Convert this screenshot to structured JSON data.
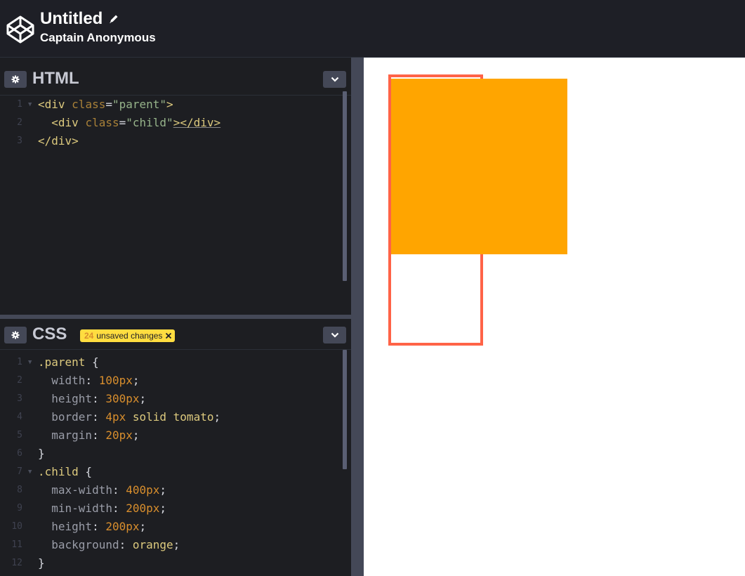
{
  "header": {
    "title": "Untitled",
    "owner": "Captain Anonymous"
  },
  "html_editor": {
    "title": "HTML",
    "lines": [
      {
        "n": "1",
        "fold": true,
        "tokens": [
          [
            "tag",
            "<div "
          ],
          [
            "attr",
            "class"
          ],
          [
            "plain",
            "="
          ],
          [
            "str",
            "\"parent\""
          ],
          [
            "tag",
            ">"
          ]
        ]
      },
      {
        "n": "2",
        "fold": false,
        "tokens": [
          [
            "plain",
            "  "
          ],
          [
            "tag",
            "<div "
          ],
          [
            "attr",
            "class"
          ],
          [
            "plain",
            "="
          ],
          [
            "str",
            "\"child\""
          ],
          [
            "tag",
            "></div>"
          ]
        ]
      },
      {
        "n": "3",
        "fold": false,
        "tokens": [
          [
            "tag",
            "</div>"
          ]
        ]
      }
    ]
  },
  "css_editor": {
    "title": "CSS",
    "badge": {
      "count": "24",
      "label": "unsaved changes"
    },
    "lines": [
      {
        "n": "1",
        "fold": true,
        "tokens": [
          [
            "sel",
            ".parent"
          ],
          [
            "plain",
            " {"
          ]
        ]
      },
      {
        "n": "2",
        "fold": false,
        "tokens": [
          [
            "prop",
            "  width"
          ],
          [
            "plain",
            ": "
          ],
          [
            "num",
            "100px"
          ],
          [
            "plain",
            ";"
          ]
        ]
      },
      {
        "n": "3",
        "fold": false,
        "tokens": [
          [
            "prop",
            "  height"
          ],
          [
            "plain",
            ": "
          ],
          [
            "num",
            "300px"
          ],
          [
            "plain",
            ";"
          ]
        ]
      },
      {
        "n": "4",
        "fold": false,
        "tokens": [
          [
            "prop",
            "  border"
          ],
          [
            "plain",
            ": "
          ],
          [
            "num",
            "4px"
          ],
          [
            "kw",
            " solid tomato"
          ],
          [
            "plain",
            ";"
          ]
        ]
      },
      {
        "n": "5",
        "fold": false,
        "tokens": [
          [
            "prop",
            "  margin"
          ],
          [
            "plain",
            ": "
          ],
          [
            "num",
            "20px"
          ],
          [
            "plain",
            ";"
          ]
        ]
      },
      {
        "n": "6",
        "fold": false,
        "tokens": [
          [
            "plain",
            "}"
          ]
        ]
      },
      {
        "n": "7",
        "fold": true,
        "tokens": [
          [
            "sel",
            ".child"
          ],
          [
            "plain",
            " {"
          ]
        ]
      },
      {
        "n": "8",
        "fold": false,
        "tokens": [
          [
            "prop",
            "  max-width"
          ],
          [
            "plain",
            ": "
          ],
          [
            "num",
            "400px"
          ],
          [
            "plain",
            ";"
          ]
        ]
      },
      {
        "n": "9",
        "fold": false,
        "tokens": [
          [
            "prop",
            "  min-width"
          ],
          [
            "plain",
            ": "
          ],
          [
            "num",
            "200px"
          ],
          [
            "plain",
            ";"
          ]
        ]
      },
      {
        "n": "10",
        "fold": false,
        "tokens": [
          [
            "prop",
            "  height"
          ],
          [
            "plain",
            ": "
          ],
          [
            "num",
            "200px"
          ],
          [
            "plain",
            ";"
          ]
        ]
      },
      {
        "n": "11",
        "fold": false,
        "tokens": [
          [
            "prop",
            "  background"
          ],
          [
            "plain",
            ": "
          ],
          [
            "kw",
            "orange"
          ],
          [
            "plain",
            ";"
          ]
        ]
      },
      {
        "n": "12",
        "fold": false,
        "tokens": [
          [
            "plain",
            "}"
          ]
        ]
      }
    ]
  },
  "preview": {
    "parent_border_color": "#ff6347",
    "child_background": "#ffa500"
  },
  "icons": {
    "logo": "codepen-logo-icon",
    "edit": "pencil-icon",
    "settings": "gear-icon",
    "collapse": "chevron-down-icon",
    "dismiss": "close-icon"
  }
}
